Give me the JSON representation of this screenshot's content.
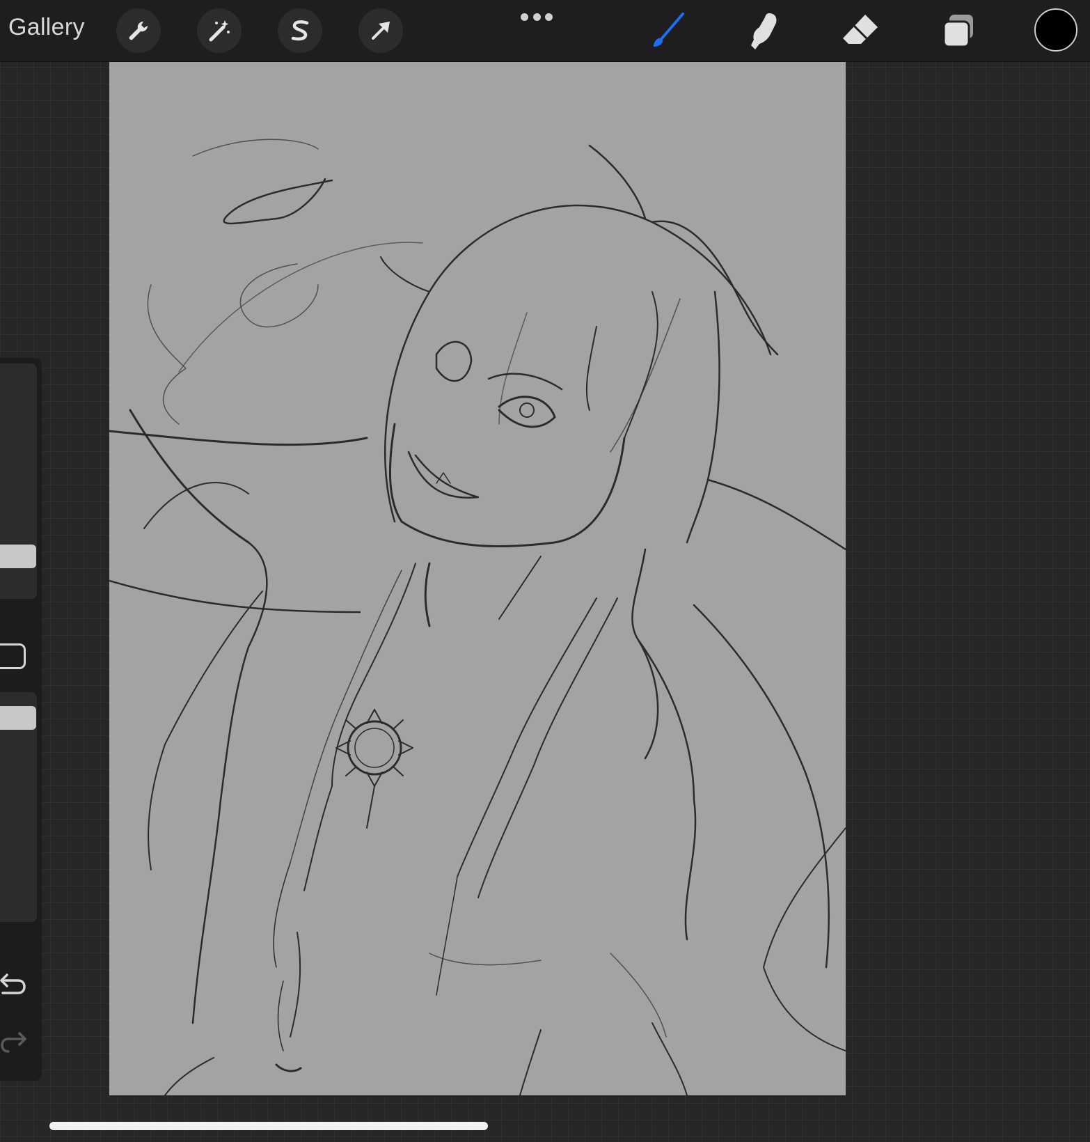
{
  "app": {
    "gallery_label": "Gallery"
  },
  "toolbar": {
    "left_tools": [
      {
        "name": "actions",
        "icon": "wrench-icon"
      },
      {
        "name": "adjustments",
        "icon": "magic-wand-icon"
      },
      {
        "name": "selection",
        "icon": "selection-s-icon"
      },
      {
        "name": "transform",
        "icon": "arrow-cursor-icon"
      }
    ],
    "more_icon": "more-dots-icon",
    "right_tools": [
      {
        "name": "brush",
        "icon": "brush-icon",
        "active": true
      },
      {
        "name": "smudge",
        "icon": "smudge-finger-icon",
        "active": false
      },
      {
        "name": "eraser",
        "icon": "eraser-icon",
        "active": false
      },
      {
        "name": "layers",
        "icon": "layers-icon",
        "active": false
      }
    ],
    "current_color": "#000000",
    "active_tool_color": "#1a6ff5"
  },
  "sidebar": {
    "brush_size_level": 0.78,
    "brush_opacity_level": 0.95,
    "undo_icon": "undo-arrow-icon",
    "redo_icon": "redo-arrow-icon",
    "modify_icon": "eyedropper-square-icon"
  },
  "canvas": {
    "background_color": "#a3a3a3",
    "stroke_color": "#2a2a2a",
    "content": "sketch-drawing"
  }
}
